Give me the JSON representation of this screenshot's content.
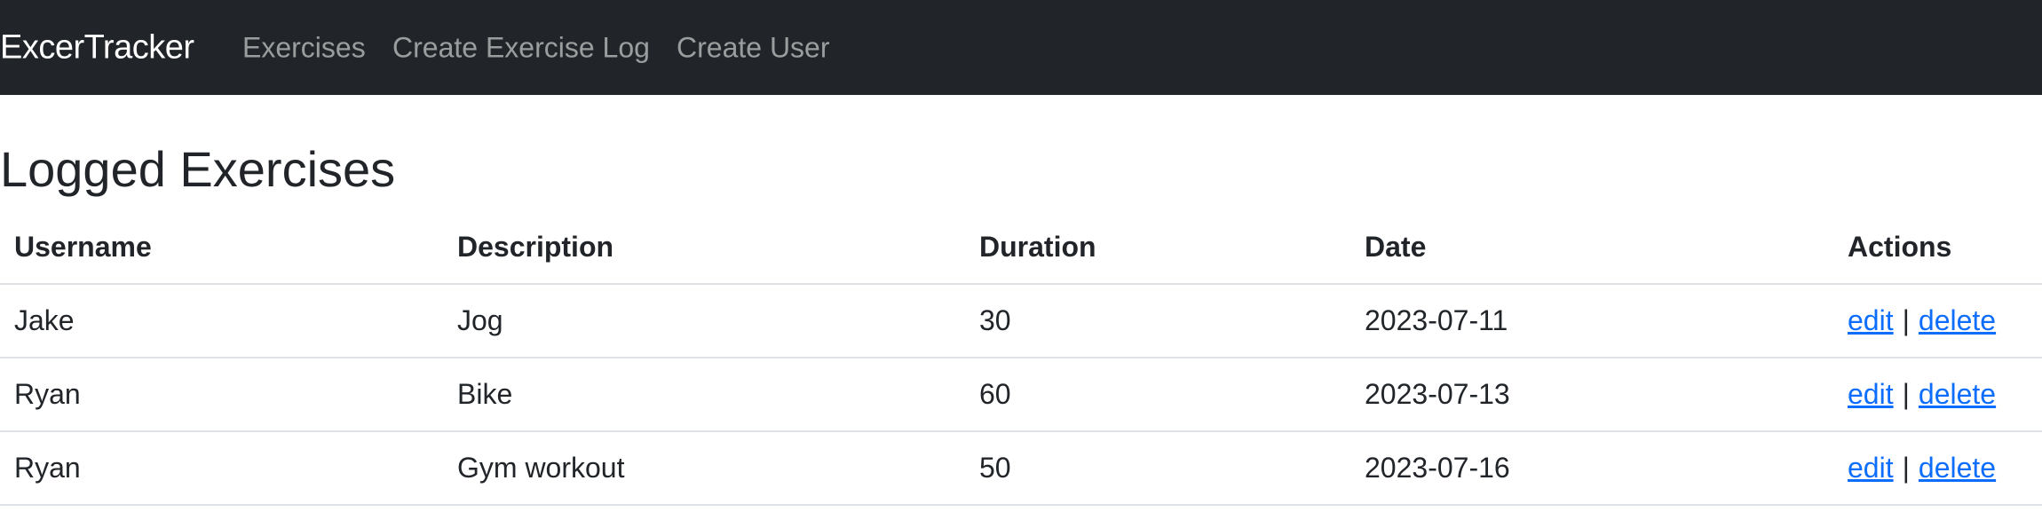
{
  "navbar": {
    "brand": "ExcerTracker",
    "links": [
      "Exercises",
      "Create Exercise Log",
      "Create User"
    ]
  },
  "page": {
    "title": "Logged Exercises"
  },
  "table": {
    "headers": [
      "Username",
      "Description",
      "Duration",
      "Date",
      "Actions"
    ],
    "rows": [
      {
        "username": "Jake",
        "description": "Jog",
        "duration": "30",
        "date": "2023-07-11",
        "edit": "edit",
        "separator": "|",
        "delete": "delete"
      },
      {
        "username": "Ryan",
        "description": "Bike",
        "duration": "60",
        "date": "2023-07-13",
        "edit": "edit",
        "separator": "|",
        "delete": "delete"
      },
      {
        "username": "Ryan",
        "description": "Gym workout",
        "duration": "50",
        "date": "2023-07-16",
        "edit": "edit",
        "separator": "|",
        "delete": "delete"
      }
    ]
  },
  "colors": {
    "navbar_bg": "#212529",
    "link": "#0d6efd",
    "text": "#212529"
  }
}
